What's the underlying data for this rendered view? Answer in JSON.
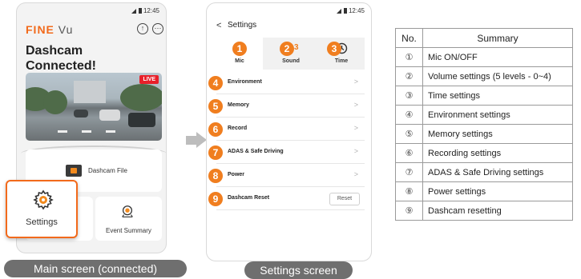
{
  "main_screen": {
    "status_time": "12:45",
    "logo_text": "FINE",
    "logo_suffix": "Vu",
    "title_line1": "Dashcam",
    "title_line2": "Connected!",
    "live_badge": "LIVE",
    "dashcam_file_label": "Dashcam File",
    "settings_label": "Settings",
    "event_summary_label": "Event Summary",
    "caption": "Main screen (connected)"
  },
  "settings_screen": {
    "status_time": "12:45",
    "back_icon": "<",
    "title": "Settings",
    "tabs": [
      {
        "badge": "1",
        "icon": "mic-icon",
        "label": "Mic"
      },
      {
        "badge": "2",
        "icon": "speaker-icon",
        "label": "Sound",
        "level": "3"
      },
      {
        "badge": "3",
        "icon": "clock-icon",
        "label": "Time"
      }
    ],
    "rows": [
      {
        "badge": "4",
        "label": "Environment"
      },
      {
        "badge": "5",
        "label": "Memory"
      },
      {
        "badge": "6",
        "label": "Record"
      },
      {
        "badge": "7",
        "label": "ADAS & Safe Driving"
      },
      {
        "badge": "8",
        "label": "Power"
      },
      {
        "badge": "9",
        "label": "Dashcam Reset",
        "button": "Reset"
      }
    ],
    "caption": "Settings screen"
  },
  "summary_table": {
    "headers": [
      "No.",
      "Summary"
    ],
    "rows": [
      {
        "no": "①",
        "text": "Mic ON/OFF"
      },
      {
        "no": "②",
        "text": "Volume settings (5 levels - 0~4)"
      },
      {
        "no": "③",
        "text": "Time settings"
      },
      {
        "no": "④",
        "text": "Environment settings"
      },
      {
        "no": "⑤",
        "text": "Memory settings"
      },
      {
        "no": "⑥",
        "text": "Recording settings"
      },
      {
        "no": "⑦",
        "text": "ADAS & Safe Driving settings"
      },
      {
        "no": "⑧",
        "text": "Power settings"
      },
      {
        "no": "⑨",
        "text": "Dashcam resetting"
      }
    ]
  },
  "colors": {
    "accent": "#f26a1b",
    "badge": "#f07e1f",
    "live": "#e8202a",
    "caption_bg": "#6f6f6f"
  }
}
